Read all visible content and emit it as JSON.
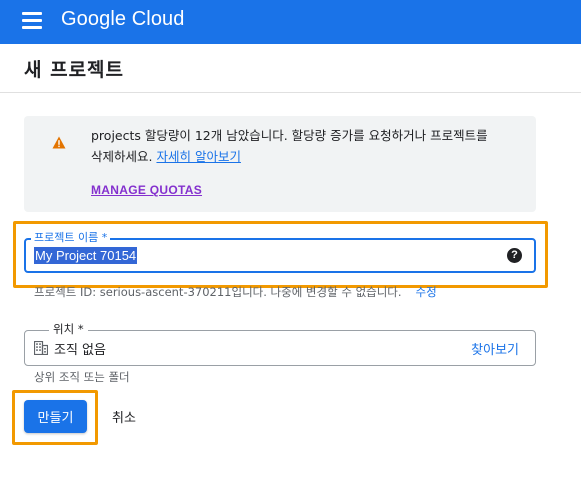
{
  "app": {
    "brand": "Google Cloud",
    "brand_color": "#1a73e8"
  },
  "page": {
    "title": "새 프로젝트"
  },
  "notice": {
    "line1": "projects 할당량이 12개 남았습니다. 할당량 증가를 요청하거나 프로젝트를",
    "line2_prefix": "삭제하세요.",
    "learn_more": "자세히 알아보기",
    "manage_quotas": "MANAGE QUOTAS",
    "icon": "warning-icon"
  },
  "project_name": {
    "label": "프로젝트 이름 *",
    "value": "My Project 70154",
    "help_icon": "?"
  },
  "project_id": {
    "text": "프로젝트 ID: serious-ascent-370211입니다. 나중에 변경할 수 없습니다.",
    "edit": "수정"
  },
  "location": {
    "label": "위치 *",
    "value": "조직 없음",
    "browse": "찾아보기",
    "hint": "상위 조직 또는 폴더",
    "icon": "building-icon"
  },
  "actions": {
    "create": "만들기",
    "cancel": "취소"
  },
  "colors": {
    "highlight": "#f29900",
    "link": "#1a73e8",
    "visited": "#8430ce"
  }
}
